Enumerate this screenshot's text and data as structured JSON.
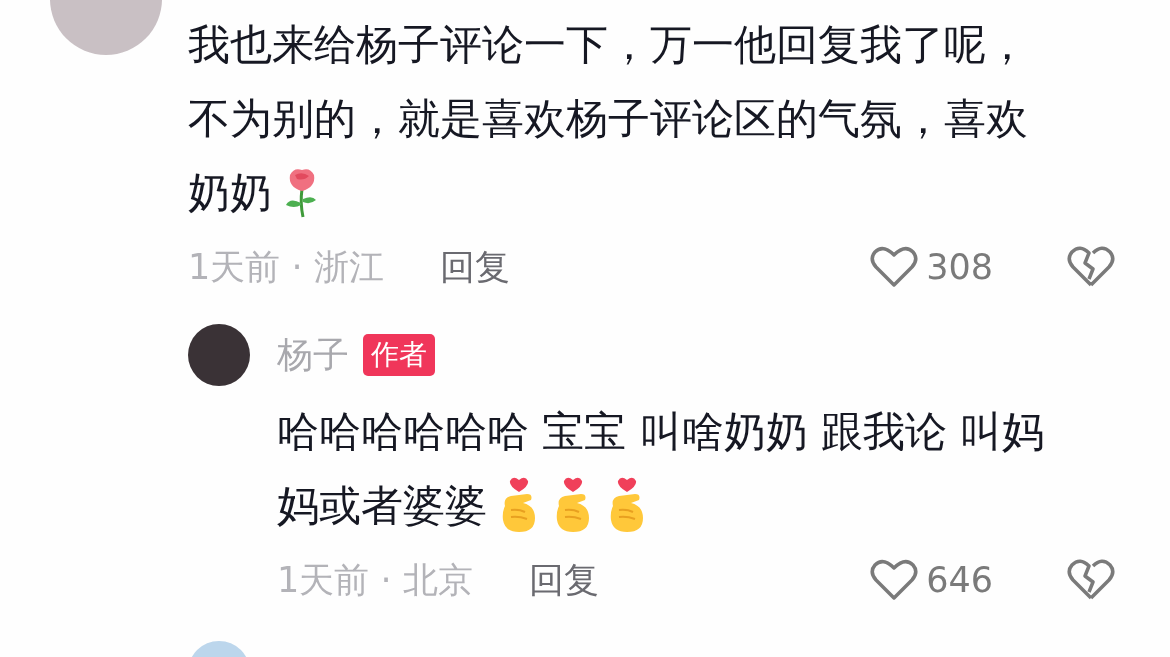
{
  "comments": [
    {
      "lines": [
        "我也来给杨子评论一下，万一他回复我了呢，",
        "不为别的，就是喜欢杨子评论区的气氛，喜欢",
        "奶奶"
      ],
      "emoji": [
        {
          "kind": "rose"
        }
      ],
      "time_location": "1天前 · 浙江",
      "reply_label": "回复",
      "likes": "308",
      "liked": false,
      "replies": [
        {
          "author": "杨子",
          "badge": "作者",
          "lines": [
            "哈哈哈哈哈哈 宝宝 叫啥奶奶 跟我论 叫妈",
            "妈或者婆婆"
          ],
          "emoji": [
            {
              "kind": "finger-heart"
            },
            {
              "kind": "finger-heart"
            },
            {
              "kind": "finger-heart"
            }
          ],
          "time_location": "1天前 · 北京",
          "reply_label": "回复",
          "likes": "646",
          "liked": false
        }
      ]
    }
  ]
}
